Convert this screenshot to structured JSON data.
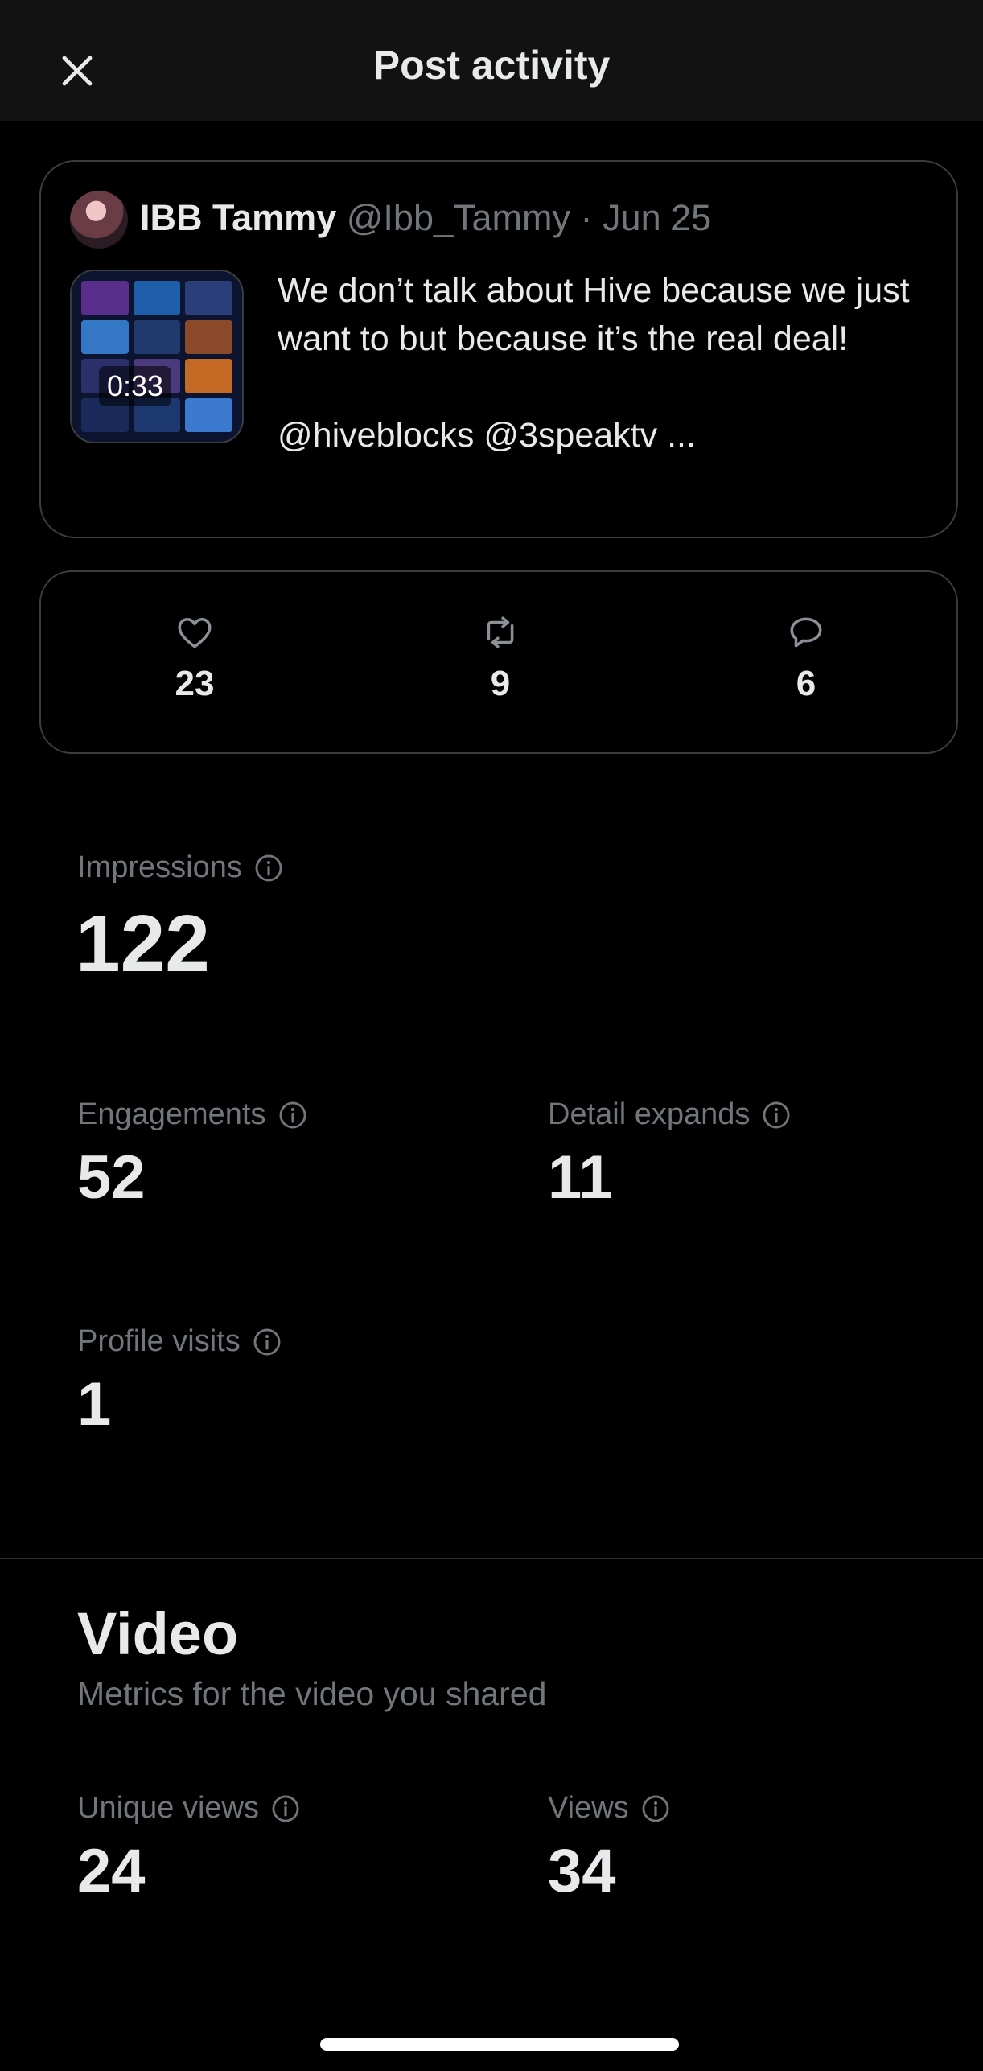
{
  "header": {
    "title": "Post activity",
    "close_icon": "close-icon"
  },
  "post": {
    "author_name": "IBB Tammy",
    "author_handle": "@Ibb_Tammy",
    "separator": "·",
    "date": "Jun 25",
    "video_duration": "0:33",
    "text": "We don’t talk about Hive because we just want to but because it’s the real deal!",
    "mentions": "@hiveblocks @3speaktv ..."
  },
  "engagement": {
    "likes": "23",
    "reposts": "9",
    "replies": "6",
    "icons": [
      "heart-icon",
      "repost-icon",
      "reply-icon"
    ]
  },
  "metrics": {
    "impressions_label": "Impressions",
    "impressions_value": "122",
    "engagements_label": "Engagements",
    "engagements_value": "52",
    "detail_expands_label": "Detail expands",
    "detail_expands_value": "11",
    "profile_visits_label": "Profile visits",
    "profile_visits_value": "1"
  },
  "video": {
    "title": "Video",
    "subtitle": "Metrics for the video you shared",
    "unique_views_label": "Unique views",
    "unique_views_value": "24",
    "views_label": "Views",
    "views_value": "34"
  },
  "colors": {
    "background": "#000000",
    "header_bg": "#121212",
    "text_primary": "#e7e9ea",
    "text_secondary": "#71767b",
    "border": "#3a3d40"
  }
}
